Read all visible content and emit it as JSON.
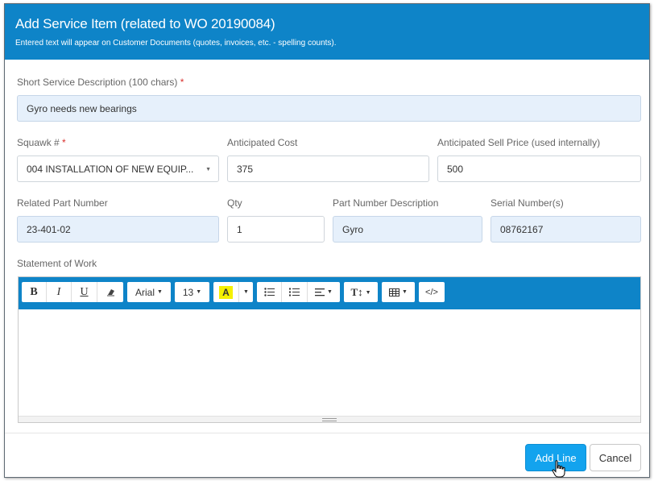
{
  "dialog": {
    "title": "Add Service Item (related to WO 20190084)",
    "subtitle": "Entered text will appear on Customer Documents (quotes, invoices, etc. - spelling counts)."
  },
  "form": {
    "short_desc": {
      "label": "Short Service Description (100 chars)",
      "required": "*",
      "value": "Gyro needs new bearings"
    },
    "squawk": {
      "label": "Squawk #",
      "required": "*",
      "value": "004 INSTALLATION OF NEW EQUIP..."
    },
    "anticipated_cost": {
      "label": "Anticipated Cost",
      "value": "375"
    },
    "anticipated_sell": {
      "label": "Anticipated Sell Price (used internally)",
      "value": "500"
    },
    "related_part": {
      "label": "Related Part Number",
      "value": "23-401-02"
    },
    "qty": {
      "label": "Qty",
      "value": "1"
    },
    "part_desc": {
      "label": "Part Number Description",
      "value": "Gyro"
    },
    "serial": {
      "label": "Serial Number(s)",
      "value": "08762167"
    },
    "statement_of_work": {
      "label": "Statement of Work",
      "value": ""
    }
  },
  "toolbar": {
    "bold": "B",
    "italic": "I",
    "underline": "U",
    "font_name": "Arial",
    "font_size": "13",
    "color_letter": "A",
    "height": "T↕",
    "code": "</>"
  },
  "buttons": {
    "add_line": "Add Line",
    "cancel": "Cancel"
  },
  "colors": {
    "header": "#0e84c8",
    "primary": "#13a3ee",
    "filled_field": "#e6f0fb",
    "required": "#d9302d",
    "highlight": "#f5f000"
  }
}
